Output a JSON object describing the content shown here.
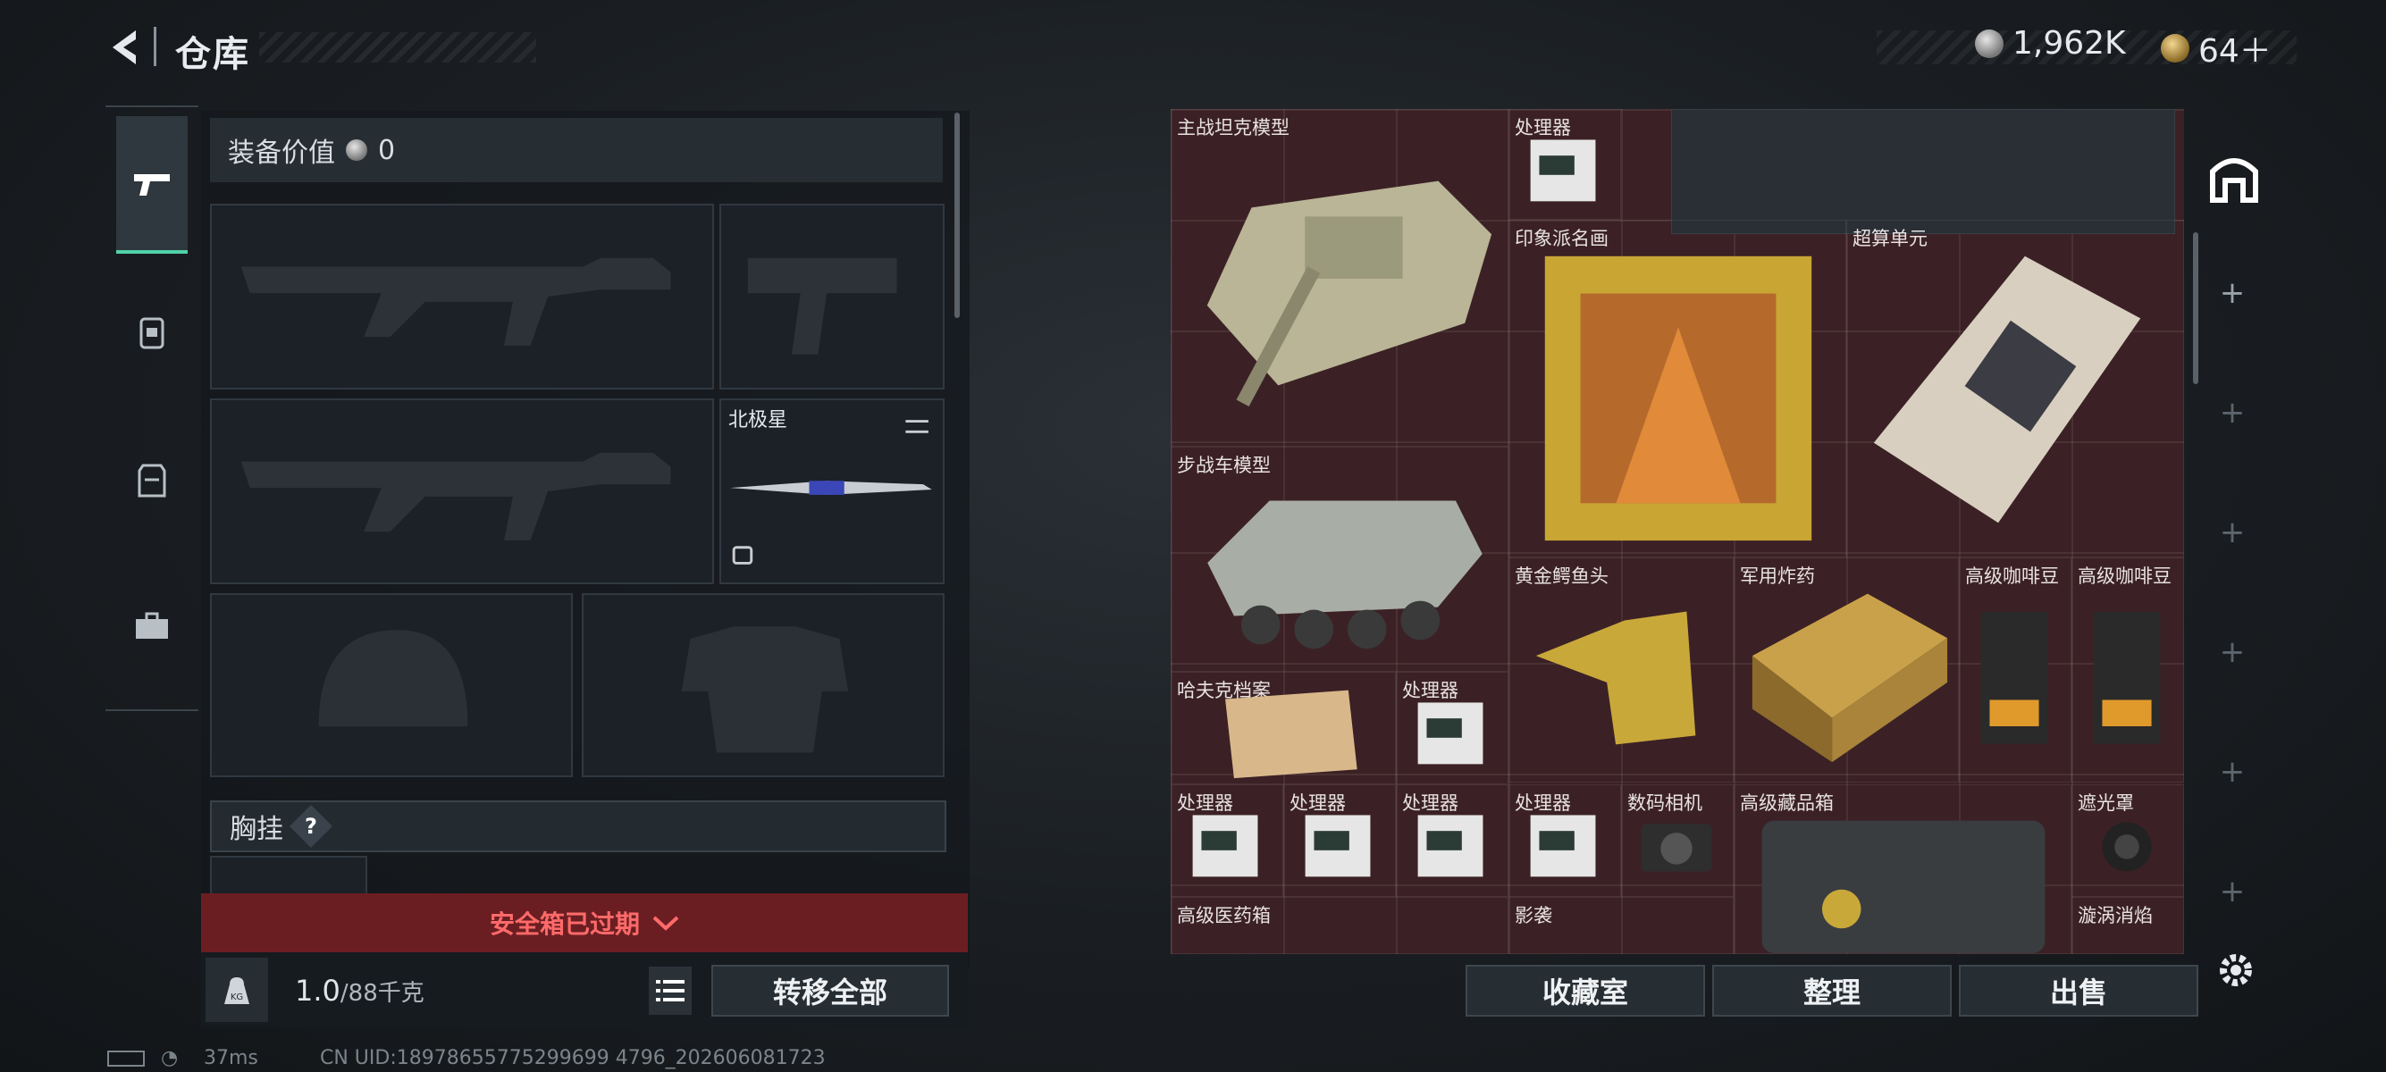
{
  "header": {
    "title": "仓库"
  },
  "currency": {
    "coins": "1,962K",
    "tickets": "64＋"
  },
  "equip": {
    "value_label": "装备价值",
    "value": "0",
    "melee_name": "北极星",
    "chest_label": "胸挂",
    "chest_help": "?",
    "expired_text": "安全箱已过期",
    "weight_current": "1.0",
    "weight_max": "/88千克",
    "transfer_all": "转移全部"
  },
  "tabs": [
    "weapon-icon",
    "backpack-icon",
    "armor-icon",
    "toolbox-icon"
  ],
  "items": [
    {
      "label": "主战坦克模型"
    },
    {
      "label": "处理器"
    },
    {
      "label": "印象派名画"
    },
    {
      "label": "超算单元"
    },
    {
      "label": "步战车模型"
    },
    {
      "label": "黄金鳄鱼头"
    },
    {
      "label": "军用炸药"
    },
    {
      "label": "高级咖啡豆"
    },
    {
      "label": "高级咖啡豆"
    },
    {
      "label": "哈夫克档案"
    },
    {
      "label": "处理器"
    },
    {
      "label": "处理器"
    },
    {
      "label": "处理器"
    },
    {
      "label": "处理器"
    },
    {
      "label": "处理器"
    },
    {
      "label": "数码相机"
    },
    {
      "label": "高级藏品箱"
    },
    {
      "label": "遮光罩"
    },
    {
      "label": "高级医药箱"
    },
    {
      "label": "影袭"
    },
    {
      "label": "漩涡消焰"
    }
  ],
  "grid_buttons": {
    "collection": "收藏室",
    "sort": "整理",
    "sell": "出售"
  },
  "status": {
    "ping": "37ms",
    "uid": "CN UID:18978655775299699 4796_202606081723"
  },
  "colors": {
    "accent": "#4fd3a8",
    "expired": "#ff6a6a",
    "grid_bg": "#3b2125"
  }
}
